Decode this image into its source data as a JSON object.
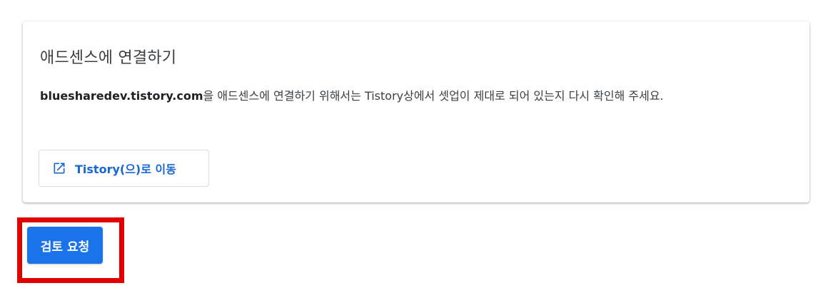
{
  "card": {
    "title": "애드센스에 연결하기",
    "body_domain": "bluesharedev.tistory.com",
    "body_text": "을 애드센스에 연결하기 위해서는 Tistory상에서 셋업이 제대로 되어 있는지 다시 확인해 주세요.",
    "link_button_label": "Tistory(으)로 이동",
    "link_button_icon": "open-in-new-icon"
  },
  "actions": {
    "review_request_label": "검토 요청"
  },
  "colors": {
    "accent": "#1a73e8",
    "link": "#1967d2",
    "highlight": "#e00000"
  }
}
